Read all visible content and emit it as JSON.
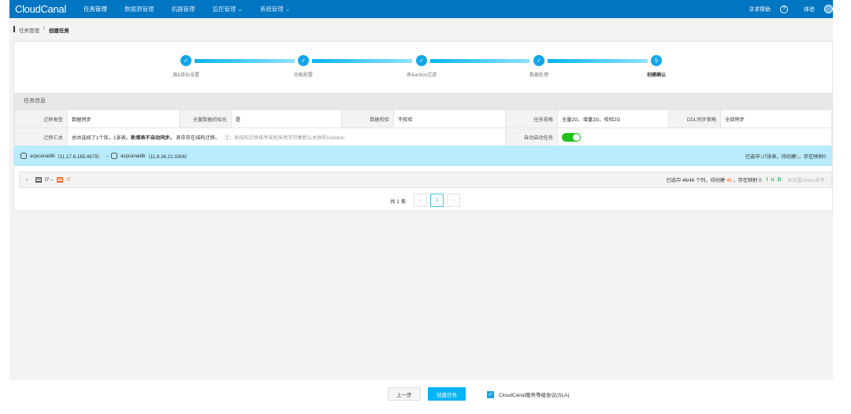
{
  "header": {
    "logo": "CloudCanal",
    "nav": [
      "任务管理",
      "数据源管理",
      "机器管理",
      "监控管理 ⌄",
      "系统管理 ⌄"
    ],
    "help": "寻求帮助",
    "user": "体验"
  },
  "breadcrumb": {
    "parent": "任务管理",
    "current": "创建任务"
  },
  "steps": [
    {
      "label": "源&目标设置",
      "mark": "✓"
    },
    {
      "label": "功能配置",
      "mark": "✓"
    },
    {
      "label": "表&action过滤",
      "mark": "✓"
    },
    {
      "label": "数据处理",
      "mark": "✓"
    },
    {
      "label": "创建确认",
      "mark": "5"
    }
  ],
  "info": {
    "title": "任务信息",
    "row1": [
      {
        "k": "迁移类型",
        "v": "数据同步"
      },
      {
        "k": "全量数据初始化",
        "v": "是"
      },
      {
        "k": "数据校验",
        "v": "不校验"
      },
      {
        "k": "任务规格",
        "v": "全量2G、增量2G、校验2G"
      },
      {
        "k": "DDL同步策略",
        "v": "全部同步"
      }
    ],
    "summary_label": "迁移汇总",
    "summary_a": "总共选择了1个库，1张表。",
    "summary_b": "新增表不自动同步。",
    "summary_c": "其中存在结构迁移。",
    "summary_note": "注：表结构迁移排序规则采用字符集默认关联的collation",
    "auto_label": "自动启动任务",
    "auto_start": true
  },
  "db": {
    "source": "acpcanaldb",
    "source_addr": "（11.17.6.185:4679）",
    "target": "acpcanaldb",
    "target_addr": "（11.8.36.21:3306）",
    "s1": "已选中",
    "sel": "1",
    "s2": "/7张表，待创建",
    "create": "1",
    "s3": "，存在映射0"
  },
  "table": {
    "source": "t7",
    "target": "t7",
    "s1": "已选中 46/46 个列，待创建 ",
    "create": "46",
    "s2": " ，存在映射 0",
    "i": "I",
    "u": "U",
    "d": "D",
    "where": "未设置where条件"
  },
  "pager": {
    "total": "共 1 条",
    "page": "1"
  },
  "footer": {
    "prev": "上一步",
    "create": "创建任务",
    "sla": "CloudCanal服务等级协议(SLA)",
    "sla_checked": true
  },
  "colors": {
    "header": "#0075c1",
    "accent": "#06b4f5",
    "toggle": "#21c01b",
    "highlight": "#f26522"
  }
}
